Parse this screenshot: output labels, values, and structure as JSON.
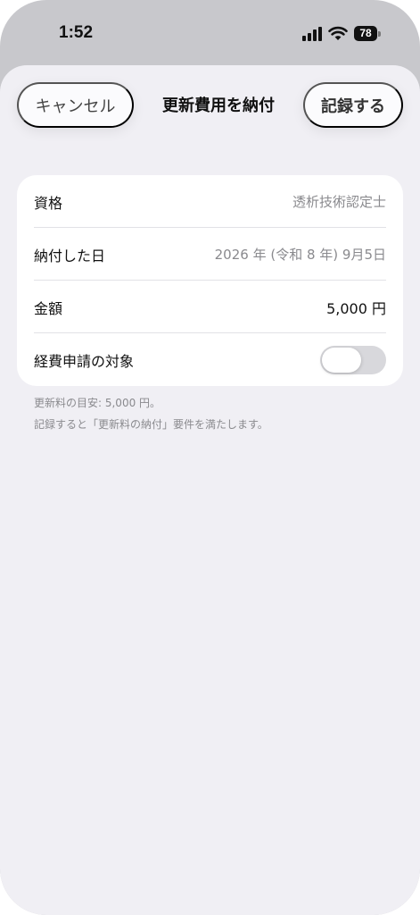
{
  "status_bar": {
    "time": "1:52",
    "battery_level": "78",
    "icons": [
      "signal-icon",
      "wifi-icon",
      "battery-icon"
    ]
  },
  "nav": {
    "cancel_label": "キャンセル",
    "title": "更新費用を納付",
    "save_label": "記録する"
  },
  "form": {
    "rows": [
      {
        "label": "資格",
        "value": "透析技術認定士"
      },
      {
        "label": "納付した日",
        "value": "2026 年 (令和 8 年) 9月5日"
      },
      {
        "label": "金額",
        "value": "5,000  円"
      },
      {
        "label": "経費申請の対象",
        "toggle_on": false
      }
    ]
  },
  "footnotes": {
    "line1": "更新料の目安: 5,000 円。",
    "line2": "記録すると「更新料の納付」要件を満たします。"
  },
  "colors": {
    "sheet_bg": "#f0eff4",
    "card_bg": "#ffffff",
    "toggle_off": "#d8d8dc"
  }
}
